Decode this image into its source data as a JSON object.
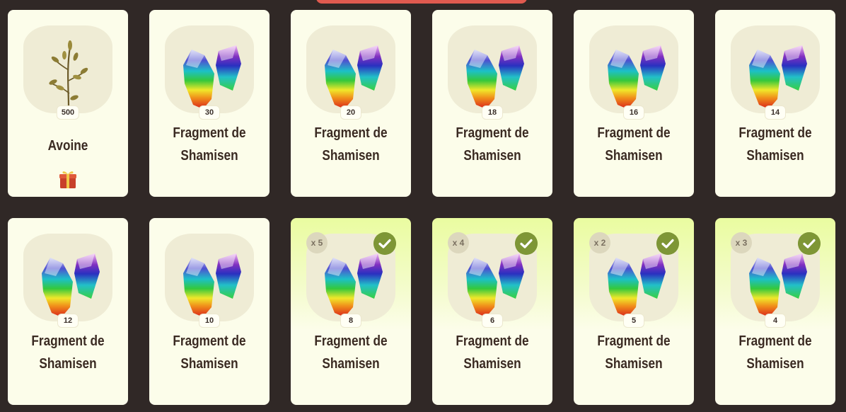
{
  "cards": [
    {
      "name_line1": "Avoine",
      "name_line2": "",
      "qty": "500",
      "multiplier": "",
      "item_icon": "oat-icon",
      "reward_icon": "gift-box-icon",
      "claimed": false
    },
    {
      "name_line1": "Fragment de",
      "name_line2": "Shamisen",
      "qty": "30",
      "multiplier": "",
      "item_icon": "shamisen-fragment-icon",
      "claimed": false
    },
    {
      "name_line1": "Fragment de",
      "name_line2": "Shamisen",
      "qty": "20",
      "multiplier": "",
      "item_icon": "shamisen-fragment-icon",
      "claimed": false
    },
    {
      "name_line1": "Fragment de",
      "name_line2": "Shamisen",
      "qty": "18",
      "multiplier": "",
      "item_icon": "shamisen-fragment-icon",
      "claimed": false
    },
    {
      "name_line1": "Fragment de",
      "name_line2": "Shamisen",
      "qty": "16",
      "multiplier": "",
      "item_icon": "shamisen-fragment-icon",
      "claimed": false
    },
    {
      "name_line1": "Fragment de",
      "name_line2": "Shamisen",
      "qty": "14",
      "multiplier": "",
      "item_icon": "shamisen-fragment-icon",
      "claimed": false
    },
    {
      "name_line1": "Fragment de",
      "name_line2": "Shamisen",
      "qty": "12",
      "multiplier": "",
      "item_icon": "shamisen-fragment-icon",
      "claimed": false
    },
    {
      "name_line1": "Fragment de",
      "name_line2": "Shamisen",
      "qty": "10",
      "multiplier": "",
      "item_icon": "shamisen-fragment-icon",
      "claimed": false
    },
    {
      "name_line1": "Fragment de",
      "name_line2": "Shamisen",
      "qty": "8",
      "multiplier": "x 5",
      "item_icon": "shamisen-fragment-icon",
      "claimed": true
    },
    {
      "name_line1": "Fragment de",
      "name_line2": "Shamisen",
      "qty": "6",
      "multiplier": "x 4",
      "item_icon": "shamisen-fragment-icon",
      "claimed": true
    },
    {
      "name_line1": "Fragment de",
      "name_line2": "Shamisen",
      "qty": "5",
      "multiplier": "x 2",
      "item_icon": "shamisen-fragment-icon",
      "claimed": true
    },
    {
      "name_line1": "Fragment de",
      "name_line2": "Shamisen",
      "qty": "4",
      "multiplier": "x 3",
      "item_icon": "shamisen-fragment-icon",
      "claimed": true
    }
  ],
  "colors": {
    "background": "#302826",
    "card": "#fcfdea",
    "claimed_card": "#eafca0",
    "check_badge": "#7e9636",
    "top_tab": "#e05a4f"
  }
}
